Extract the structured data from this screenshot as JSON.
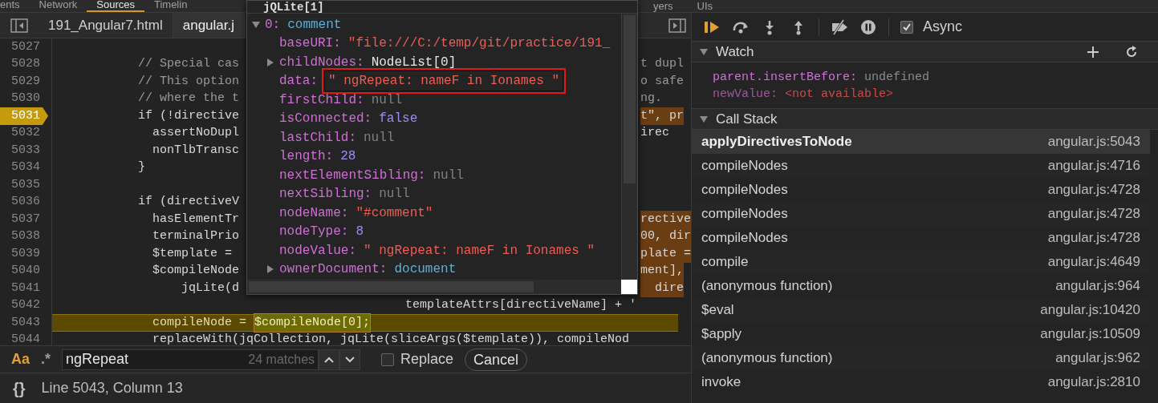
{
  "panel_tabs": [
    {
      "label": "ents",
      "selected": false
    },
    {
      "label": "Network",
      "selected": false
    },
    {
      "label": "Sources",
      "selected": true
    },
    {
      "label": "Timelin",
      "selected": false
    },
    {
      "label": "yers",
      "selected": false
    },
    {
      "label": "UIs",
      "selected": false
    }
  ],
  "editor_tabs": [
    {
      "label": "191_Angular7.html",
      "selected": false
    },
    {
      "label": "angular.j",
      "selected": true
    }
  ],
  "code_lines": [
    {
      "number": "5027",
      "breakpoint": false,
      "current": false,
      "kind": "code"
    },
    {
      "number": "5028",
      "breakpoint": false,
      "current": false,
      "kind": "comment",
      "left": "// Special cas",
      "right": "t dupl",
      "right_highlighted": false
    },
    {
      "number": "5029",
      "breakpoint": false,
      "current": false,
      "kind": "comment",
      "left": "// This option",
      "right": "o safe",
      "right_highlighted": false
    },
    {
      "number": "5030",
      "breakpoint": false,
      "current": false,
      "kind": "comment",
      "left": "// where the t",
      "right": "ng.",
      "right_highlighted": false
    },
    {
      "number": "5031",
      "breakpoint": true,
      "current": false,
      "kind": "code",
      "left": "if (!directive",
      "right": "t\", pr",
      "right_highlighted": true
    },
    {
      "number": "5032",
      "breakpoint": false,
      "current": false,
      "kind": "code",
      "left": "  assertNoDupl",
      "right": "irec",
      "right_highlighted": false
    },
    {
      "number": "5033",
      "breakpoint": false,
      "current": false,
      "kind": "code",
      "left": "  nonTlbTransc"
    },
    {
      "number": "5034",
      "breakpoint": false,
      "current": false,
      "kind": "code",
      "left": "}"
    },
    {
      "number": "5035",
      "breakpoint": false,
      "current": false,
      "kind": "code"
    },
    {
      "number": "5036",
      "breakpoint": false,
      "current": false,
      "kind": "code",
      "left": "if (directiveV"
    },
    {
      "number": "5037",
      "breakpoint": false,
      "current": false,
      "kind": "code",
      "left": "  hasElementTr",
      "right": "rective",
      "right_highlighted": true
    },
    {
      "number": "5038",
      "breakpoint": false,
      "current": false,
      "kind": "code",
      "left": "  terminalPrio",
      "right": "00, dir",
      "right_highlighted": true
    },
    {
      "number": "5039",
      "breakpoint": false,
      "current": false,
      "kind": "code",
      "left": "  $template =",
      "right": "plate =",
      "right_highlighted": true
    },
    {
      "number": "5040",
      "breakpoint": false,
      "current": false,
      "kind": "code",
      "left": "  $compileNode",
      "right": "ment],",
      "right_highlighted": true
    },
    {
      "number": "5041",
      "breakpoint": false,
      "current": false,
      "kind": "code",
      "left": "      jqLite(d",
      "right": "  dire",
      "right_highlighted": true
    },
    {
      "number": "5042",
      "breakpoint": false,
      "current": false,
      "kind": "code",
      "text": "                                     templateAttrs[directiveName] + '"
    },
    {
      "number": "5043",
      "breakpoint": false,
      "current": true,
      "kind": "code",
      "text": "  compileNode = ",
      "match": "$compileNode[0];"
    },
    {
      "number": "5044",
      "breakpoint": false,
      "current": false,
      "kind": "code",
      "text": "  replaceWith(jqCollection, jqLite(sliceArgs($template)), compileNod"
    }
  ],
  "popover": {
    "title": "jQLite[1]",
    "rows": [
      {
        "key": "0:",
        "value": "comment",
        "kind": "object",
        "expanded": true,
        "annotated": false,
        "children": [
          {
            "key": "baseURI:",
            "value": "\"file:///C:/temp/git/practice/191_",
            "kind": "string",
            "annotated": false
          },
          {
            "key": "childNodes:",
            "value": "NodeList[0]",
            "kind": "plain",
            "expanded": false,
            "annotated": false
          },
          {
            "key": "data:",
            "value": "\" ngRepeat: nameF in Ionames \"",
            "kind": "string",
            "annotated": true
          },
          {
            "key": "firstChild:",
            "value": "null",
            "kind": "null",
            "annotated": false
          },
          {
            "key": "isConnected:",
            "value": "false",
            "kind": "boolean",
            "annotated": false
          },
          {
            "key": "lastChild:",
            "value": "null",
            "kind": "null",
            "annotated": false
          },
          {
            "key": "length:",
            "value": "28",
            "kind": "number",
            "annotated": false
          },
          {
            "key": "nextElementSibling:",
            "value": "null",
            "kind": "null",
            "annotated": false
          },
          {
            "key": "nextSibling:",
            "value": "null",
            "kind": "null",
            "annotated": false
          },
          {
            "key": "nodeName:",
            "value": "\"#comment\"",
            "kind": "string",
            "annotated": false
          },
          {
            "key": "nodeType:",
            "value": "8",
            "kind": "number",
            "annotated": false
          },
          {
            "key": "nodeValue:",
            "value": "\" ngRepeat: nameF in Ionames \"",
            "kind": "string",
            "annotated": false
          },
          {
            "key": "ownerDocument:",
            "value": "document",
            "kind": "object",
            "expanded": false,
            "annotated": false
          }
        ]
      }
    ]
  },
  "search": {
    "toggles": [
      {
        "label": "Aa",
        "selected": true
      },
      {
        "label": ".*",
        "selected": false
      }
    ],
    "value": "ngRepeat",
    "matches": "24 matches",
    "replace": {
      "label": "Replace",
      "checked": false
    },
    "cancel": "Cancel"
  },
  "status_bar": {
    "format_button": "{}",
    "text": "Line 5043, Column 13"
  },
  "debugger": {
    "async": {
      "label": "Async",
      "checked": true
    },
    "watch": {
      "title": "Watch",
      "expanded": true,
      "items": [
        {
          "name": "parent.insertBefore:",
          "value": "undefined",
          "kind": "undefined"
        },
        {
          "name": "newValue:",
          "value": "<not available>",
          "kind": "unavailable"
        }
      ]
    },
    "call_stack": {
      "title": "Call Stack",
      "expanded": true,
      "frames": [
        {
          "name": "applyDirectivesToNode",
          "location": "angular.js:5043",
          "selected": true
        },
        {
          "name": "compileNodes",
          "location": "angular.js:4716",
          "selected": false
        },
        {
          "name": "compileNodes",
          "location": "angular.js:4728",
          "selected": false
        },
        {
          "name": "compileNodes",
          "location": "angular.js:4728",
          "selected": false
        },
        {
          "name": "compileNodes",
          "location": "angular.js:4728",
          "selected": false
        },
        {
          "name": "compile",
          "location": "angular.js:4649",
          "selected": false
        },
        {
          "name": "(anonymous function)",
          "location": "angular.js:964",
          "selected": false
        },
        {
          "name": "$eval",
          "location": "angular.js:10420",
          "selected": false
        },
        {
          "name": "$apply",
          "location": "angular.js:10509",
          "selected": false
        },
        {
          "name": "(anonymous function)",
          "location": "angular.js:962",
          "selected": false
        },
        {
          "name": "invoke",
          "location": "angular.js:2810",
          "selected": false
        }
      ]
    }
  }
}
